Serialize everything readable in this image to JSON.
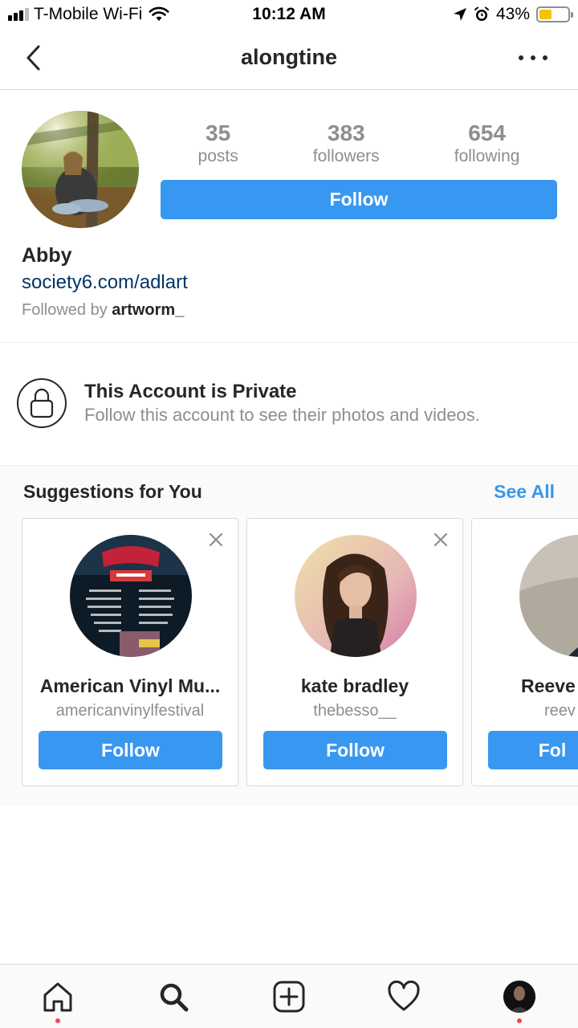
{
  "status_bar": {
    "carrier": "T-Mobile Wi-Fi",
    "time": "10:12 AM",
    "battery_percent": "43%",
    "battery_level": 0.43,
    "battery_color": "#f5c400",
    "icons": [
      "signal-icon",
      "wifi-icon",
      "location-arrow-icon",
      "alarm-icon",
      "battery-icon"
    ]
  },
  "header": {
    "title": "alongtine",
    "back_icon": "chevron-left-icon",
    "more_icon": "more-horizontal-icon"
  },
  "profile": {
    "stats": [
      {
        "value": "35",
        "label": "posts"
      },
      {
        "value": "383",
        "label": "followers"
      },
      {
        "value": "654",
        "label": "following"
      }
    ],
    "follow_label": "Follow",
    "name": "Abby",
    "website": "society6.com/adlart",
    "followed_by_prefix": "Followed by ",
    "followed_by_user": "artworm_"
  },
  "private_notice": {
    "icon": "lock-icon",
    "title": "This Account is Private",
    "subtitle": "Follow this account to see their photos and videos."
  },
  "suggestions": {
    "title": "Suggestions for You",
    "see_all": "See All",
    "cards": [
      {
        "name": "American Vinyl Mu...",
        "username": "americanvinylfestival",
        "follow_label": "Follow"
      },
      {
        "name": "kate bradley",
        "username": "thebesso__",
        "follow_label": "Follow"
      },
      {
        "name": "Reeve",
        "username": "reev",
        "follow_label": "Fol"
      }
    ]
  },
  "tab_bar": {
    "items": [
      "home-icon",
      "search-icon",
      "new-post-icon",
      "activity-heart-icon",
      "profile-avatar"
    ],
    "accent": "#3897f0",
    "notification_dot_color": "#ed4956"
  }
}
